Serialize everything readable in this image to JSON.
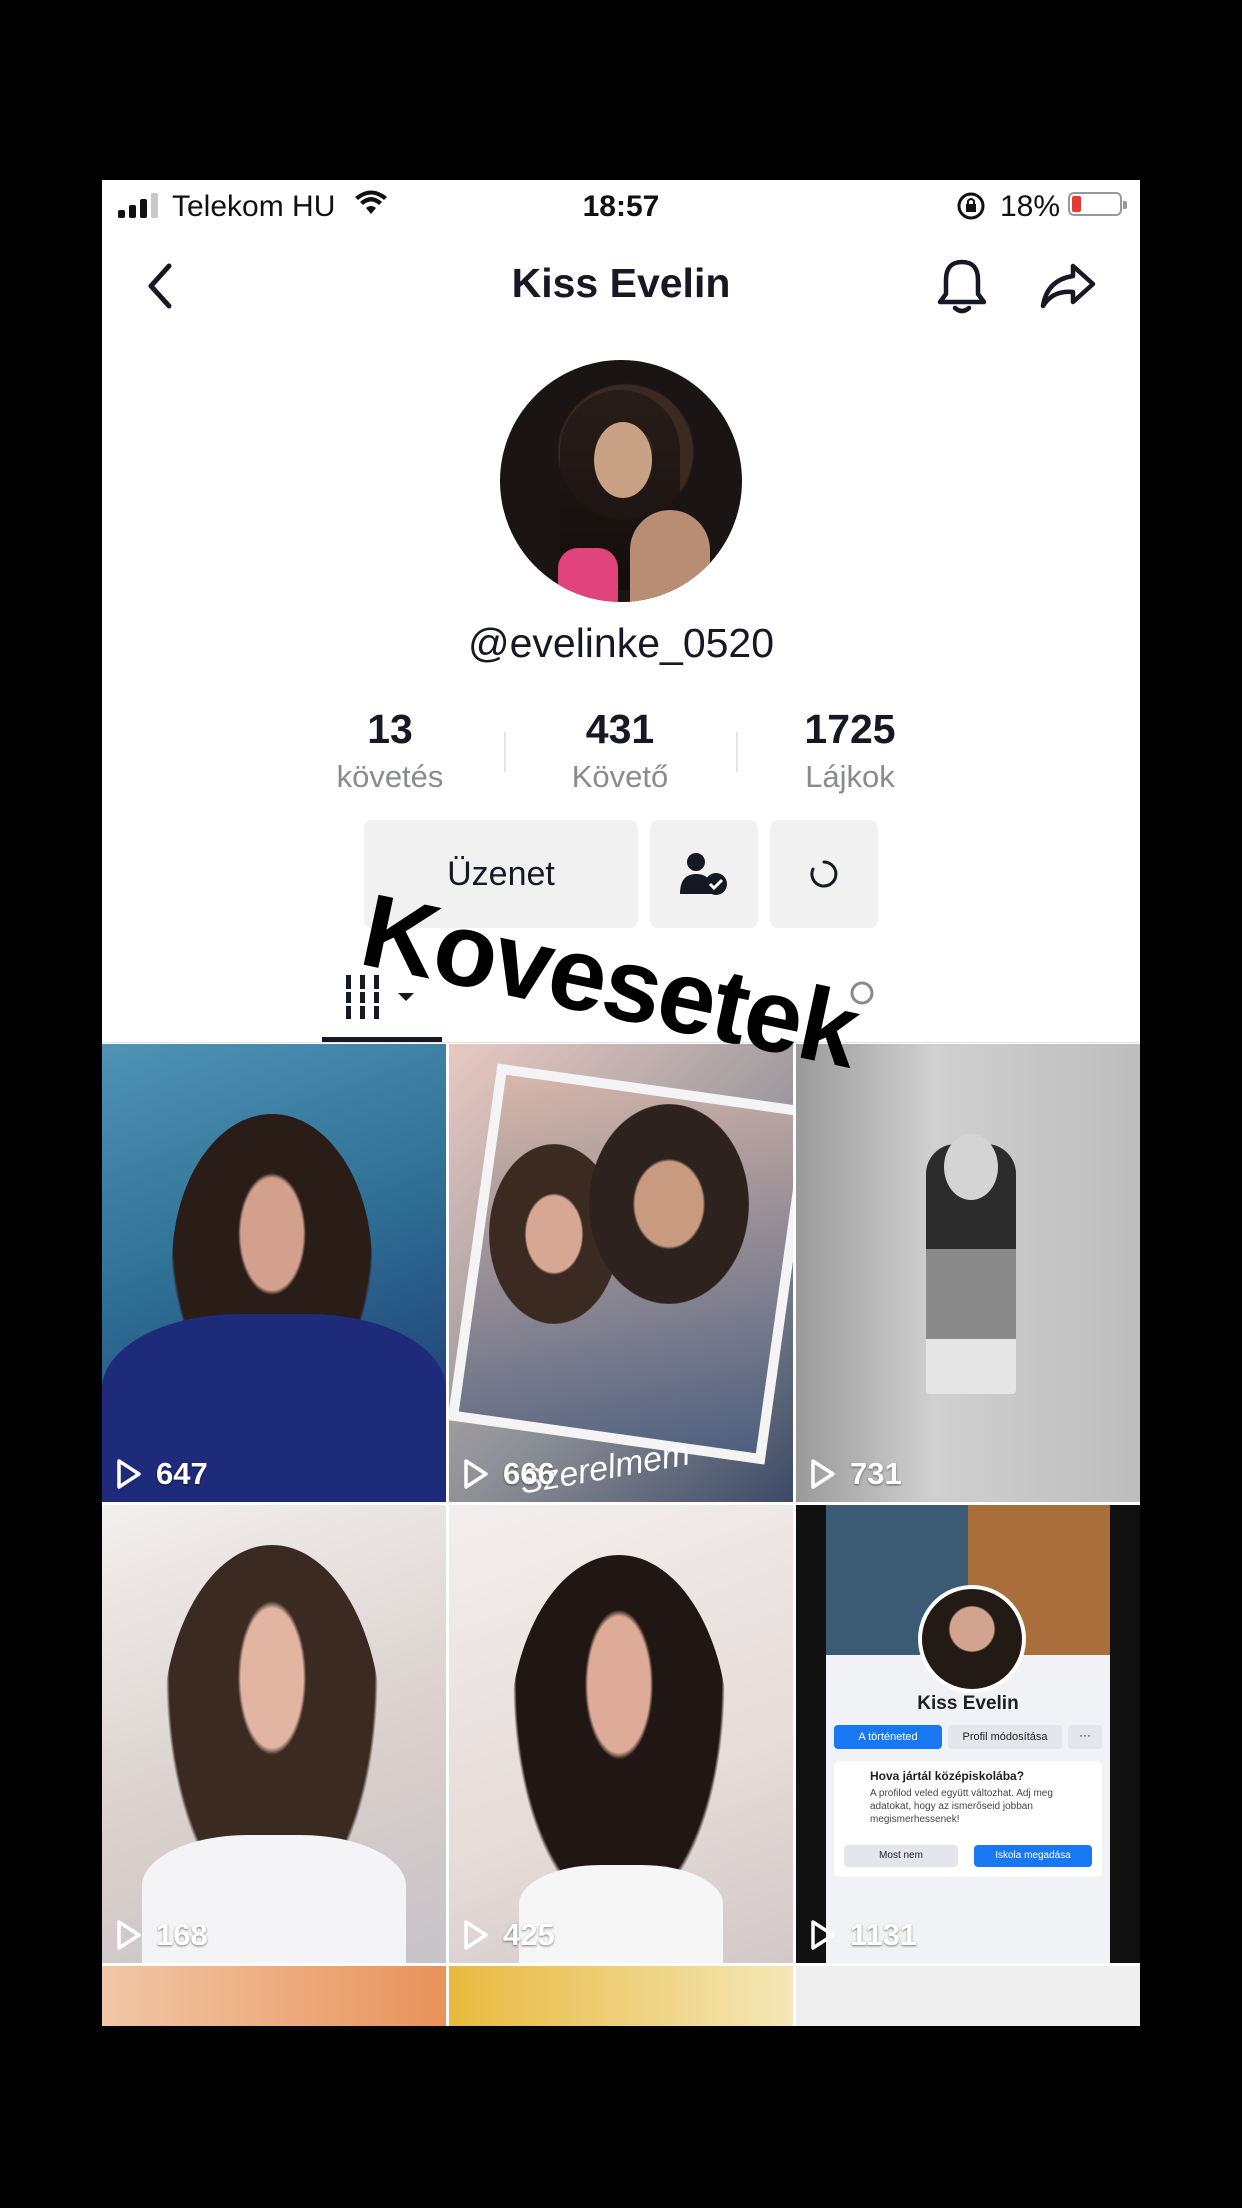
{
  "status_bar": {
    "carrier": "Telekom HU",
    "time": "18:57",
    "battery_percent": "18%",
    "battery_level": 0.18
  },
  "header": {
    "title": "Kiss Evelin",
    "back_icon": "chevron-left-icon",
    "notification_icon": "bell-icon",
    "share_icon": "share-arrow-icon"
  },
  "profile": {
    "username": "@evelinke_0520",
    "stats": [
      {
        "value": "13",
        "label": "követés"
      },
      {
        "value": "431",
        "label": "Követő"
      },
      {
        "value": "1725",
        "label": "Lájkok"
      }
    ]
  },
  "actions": {
    "message_label": "Üzenet",
    "follow_icon": "person-check-icon",
    "more_icon": "loading-circle-icon"
  },
  "tabs": [
    {
      "icon": "grid-bars-icon",
      "active": true
    },
    {
      "icon": "liked-icon",
      "active": false
    }
  ],
  "sticker_text": "Kovesetek",
  "videos": [
    {
      "views": "647",
      "overlay": ""
    },
    {
      "views": "666",
      "overlay": "Szerelmem"
    },
    {
      "views": "731",
      "overlay": ""
    },
    {
      "views": "168",
      "overlay": ""
    },
    {
      "views": "425",
      "overlay": ""
    },
    {
      "views": "1131",
      "overlay": "Kiss Evelin"
    }
  ],
  "video6_card": {
    "name": "Kiss Evelin",
    "btn1": "A történeted",
    "btn2": "Profil módosítása",
    "question": "Hova jártál középiskolába?",
    "desc": "A profilod veled együtt változhat. Adj meg adatokat, hogy az ismerőseid jobban megismerhessenek!",
    "no_btn": "Most nem",
    "yes_btn": "Iskola megadása"
  },
  "colors": {
    "accent_text": "#161823",
    "secondary_text": "#8a8b91",
    "battery_low": "#e53935",
    "fb_blue": "#1877f2"
  }
}
